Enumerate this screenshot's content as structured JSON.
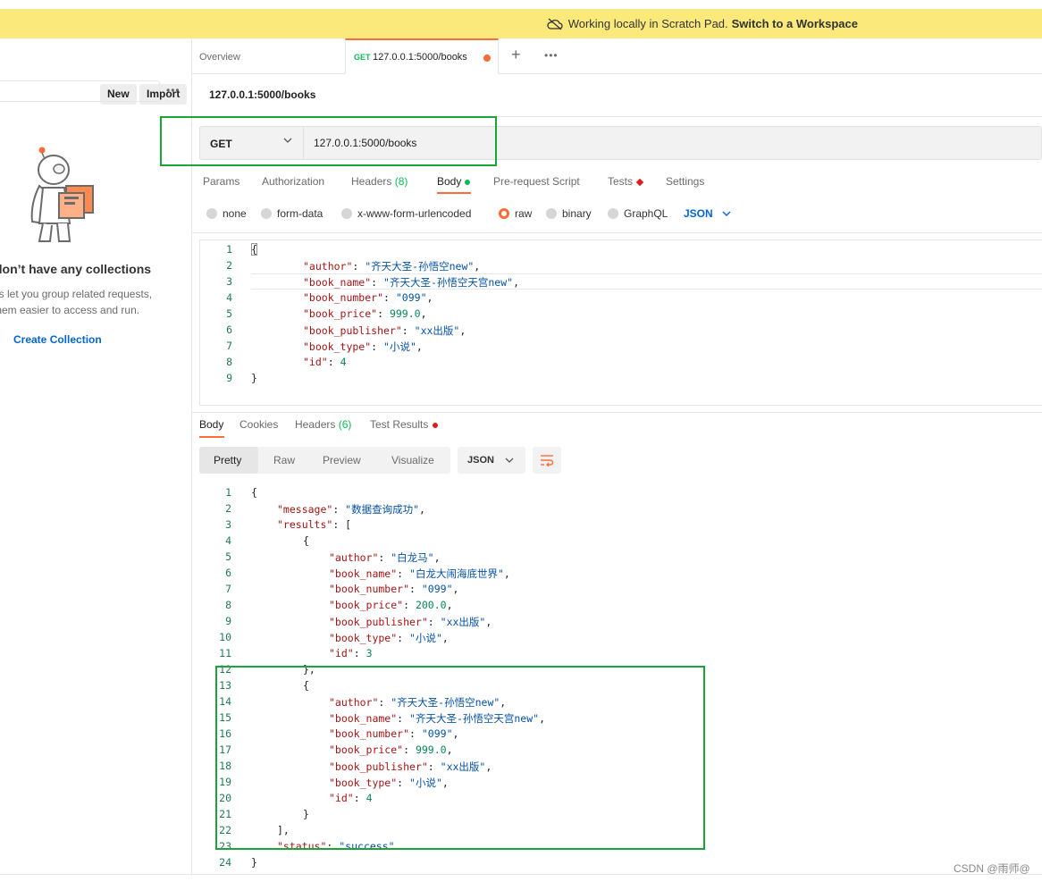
{
  "banner": {
    "text": "Working locally in Scratch Pad.",
    "link": "Switch to a Workspace"
  },
  "sidebar": {
    "new_label": "New",
    "import_label": "Import",
    "more_label": "•••",
    "empty_title": "don’t have any collections",
    "empty_desc_1": "ns let you group related requests,",
    "empty_desc_2": "them easier to access and run.",
    "create_label": "Create Collection"
  },
  "tabs": {
    "overview": "Overview",
    "active_method": "GET",
    "active_label": "127.0.0.1:5000/books",
    "plus": "+",
    "more": "•••"
  },
  "request": {
    "title": "127.0.0.1:5000/books",
    "method": "GET",
    "url": "127.0.0.1:5000/books",
    "tabs": [
      "Params",
      "Authorization",
      "Headers",
      "Body",
      "Pre-request Script",
      "Tests",
      "Settings"
    ],
    "headers_count": "(8)",
    "body_options": [
      "none",
      "form-data",
      "x-www-form-urlencoded",
      "raw",
      "binary",
      "GraphQL"
    ],
    "body_format": "JSON",
    "body_lines": [
      {
        "n": "1",
        "t": "{"
      },
      {
        "n": "2",
        "k": "\"author\"",
        "v": "\"齐天大圣-孙悟空new\"",
        "e": ","
      },
      {
        "n": "3",
        "k": "\"book_name\"",
        "v": "\"齐天大圣-孙悟空天宫new\"",
        "e": ","
      },
      {
        "n": "4",
        "k": "\"book_number\"",
        "v": "\"099\"",
        "e": ","
      },
      {
        "n": "5",
        "k": "\"book_price\"",
        "v": "999.0",
        "e": ","
      },
      {
        "n": "6",
        "k": "\"book_publisher\"",
        "v": "\"xx出版\"",
        "e": ","
      },
      {
        "n": "7",
        "k": "\"book_type\"",
        "v": "\"小说\"",
        "e": ","
      },
      {
        "n": "8",
        "k": "\"id\"",
        "v": "4",
        "e": ""
      },
      {
        "n": "9",
        "t": "}"
      }
    ]
  },
  "response": {
    "tabs": [
      "Body",
      "Cookies",
      "Headers",
      "Test Results"
    ],
    "headers_count": "(6)",
    "views": [
      "Pretty",
      "Raw",
      "Preview",
      "Visualize"
    ],
    "format": "JSON",
    "lines": [
      {
        "n": "1",
        "i": 0,
        "t": "{"
      },
      {
        "n": "2",
        "i": 1,
        "k": "\"message\"",
        "v": "\"数据查询成功\"",
        "e": ","
      },
      {
        "n": "3",
        "i": 1,
        "k": "\"results\"",
        "t2": "[",
        "e": ""
      },
      {
        "n": "4",
        "i": 2,
        "t": "{"
      },
      {
        "n": "5",
        "i": 3,
        "k": "\"author\"",
        "v": "\"白龙马\"",
        "e": ","
      },
      {
        "n": "6",
        "i": 3,
        "k": "\"book_name\"",
        "v": "\"白龙大闹海底世界\"",
        "e": ","
      },
      {
        "n": "7",
        "i": 3,
        "k": "\"book_number\"",
        "v": "\"099\"",
        "e": ","
      },
      {
        "n": "8",
        "i": 3,
        "k": "\"book_price\"",
        "v": "200.0",
        "e": ","
      },
      {
        "n": "9",
        "i": 3,
        "k": "\"book_publisher\"",
        "v": "\"xx出版\"",
        "e": ","
      },
      {
        "n": "10",
        "i": 3,
        "k": "\"book_type\"",
        "v": "\"小说\"",
        "e": ","
      },
      {
        "n": "11",
        "i": 3,
        "k": "\"id\"",
        "v": "3",
        "e": ""
      },
      {
        "n": "12",
        "i": 2,
        "t": "},"
      },
      {
        "n": "13",
        "i": 2,
        "t": "{"
      },
      {
        "n": "14",
        "i": 3,
        "k": "\"author\"",
        "v": "\"齐天大圣-孙悟空new\"",
        "e": ","
      },
      {
        "n": "15",
        "i": 3,
        "k": "\"book_name\"",
        "v": "\"齐天大圣-孙悟空天宫new\"",
        "e": ","
      },
      {
        "n": "16",
        "i": 3,
        "k": "\"book_number\"",
        "v": "\"099\"",
        "e": ","
      },
      {
        "n": "17",
        "i": 3,
        "k": "\"book_price\"",
        "v": "999.0",
        "e": ","
      },
      {
        "n": "18",
        "i": 3,
        "k": "\"book_publisher\"",
        "v": "\"xx出版\"",
        "e": ","
      },
      {
        "n": "19",
        "i": 3,
        "k": "\"book_type\"",
        "v": "\"小说\"",
        "e": ","
      },
      {
        "n": "20",
        "i": 3,
        "k": "\"id\"",
        "v": "4",
        "e": ""
      },
      {
        "n": "21",
        "i": 2,
        "t": "}"
      },
      {
        "n": "22",
        "i": 1,
        "t": "],"
      },
      {
        "n": "23",
        "i": 1,
        "k": "\"status\"",
        "v": "\"success\"",
        "e": ""
      },
      {
        "n": "24",
        "i": 0,
        "t": "}"
      }
    ]
  },
  "watermark": "CSDN @雨师@",
  "colors": {
    "accent": "#ff6c37",
    "highlight": "#1ea33a",
    "banner": "#fbe97c",
    "link": "#0265d2"
  }
}
